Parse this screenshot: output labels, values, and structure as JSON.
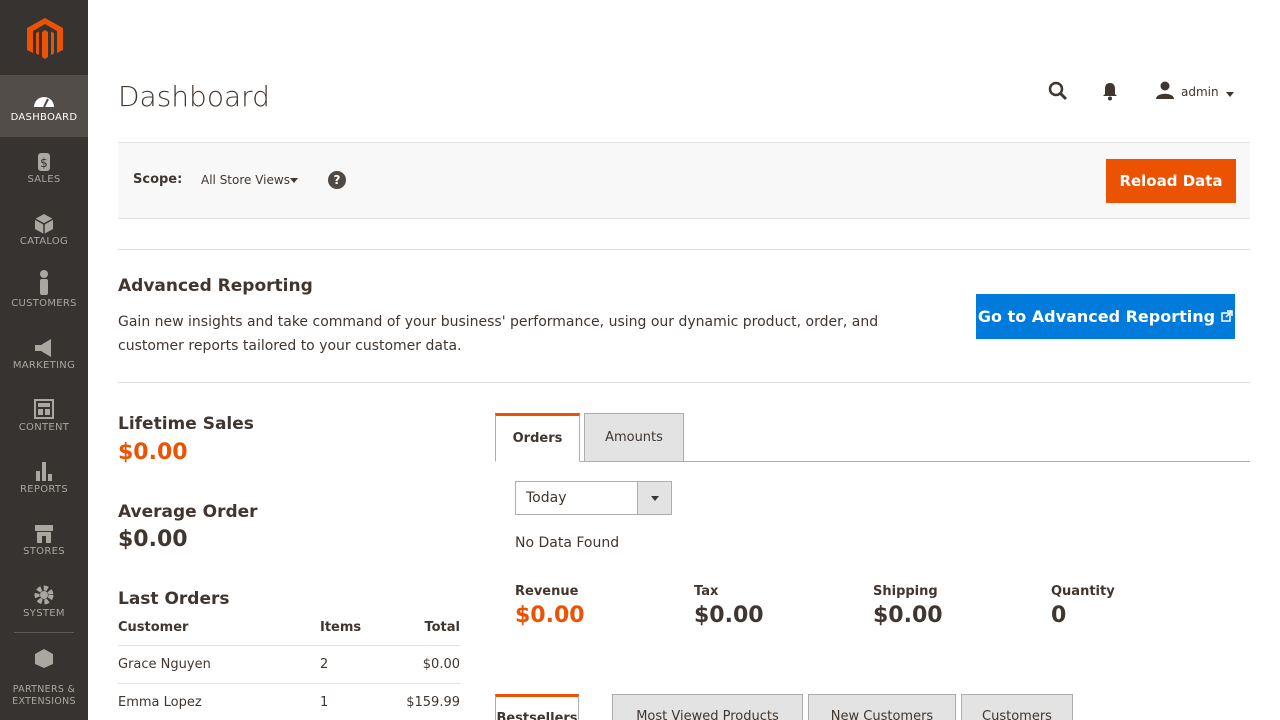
{
  "sidebar": {
    "logo": "magento-logo",
    "items": [
      {
        "label": "Dashboard",
        "icon": "dashboard-icon",
        "active": true
      },
      {
        "label": "Sales",
        "icon": "dollar-icon"
      },
      {
        "label": "Catalog",
        "icon": "cube-icon"
      },
      {
        "label": "Customers",
        "icon": "person-icon"
      },
      {
        "label": "Marketing",
        "icon": "megaphone-icon"
      },
      {
        "label": "Content",
        "icon": "layout-icon"
      },
      {
        "label": "Reports",
        "icon": "bar-chart-icon"
      },
      {
        "label": "Stores",
        "icon": "store-icon"
      },
      {
        "label": "System",
        "icon": "gear-icon"
      },
      {
        "label": "Partners & Extensions",
        "icon": "box-icon"
      }
    ]
  },
  "header": {
    "title": "Dashboard",
    "user_name": "admin"
  },
  "scope": {
    "label": "Scope:",
    "value": "All Store Views",
    "help": "?",
    "reload_label": "Reload Data"
  },
  "advanced": {
    "title": "Advanced Reporting",
    "description": "Gain new insights and take command of your business' performance, using our dynamic product, order, and customer reports tailored to your customer data.",
    "button_label": "Go to Advanced Reporting"
  },
  "stats": {
    "lifetime_label": "Lifetime Sales",
    "lifetime_value": "$0.00",
    "average_label": "Average Order",
    "average_value": "$0.00"
  },
  "last_orders": {
    "title": "Last Orders",
    "columns": [
      "Customer",
      "Items",
      "Total"
    ],
    "rows": [
      {
        "customer": "Grace Nguyen",
        "items": "2",
        "total": "$0.00"
      },
      {
        "customer": "Emma Lopez",
        "items": "1",
        "total": "$159.99"
      }
    ]
  },
  "chart_tabs": [
    {
      "label": "Orders",
      "active": true
    },
    {
      "label": "Amounts",
      "active": false
    }
  ],
  "period": {
    "value": "Today"
  },
  "no_data": "No Data Found",
  "totals": [
    {
      "label": "Revenue",
      "value": "$0.00",
      "highlight": true
    },
    {
      "label": "Tax",
      "value": "$0.00"
    },
    {
      "label": "Shipping",
      "value": "$0.00"
    },
    {
      "label": "Quantity",
      "value": "0"
    }
  ],
  "bottom_tabs": [
    {
      "label": "Bestsellers",
      "active": true
    },
    {
      "label": "Most Viewed Products",
      "active": false
    },
    {
      "label": "New Customers",
      "active": false
    },
    {
      "label": "Customers",
      "active": false
    }
  ],
  "colors": {
    "accent": "#eb5202",
    "primary_button": "#007bdb",
    "sidebar": "#373330"
  }
}
